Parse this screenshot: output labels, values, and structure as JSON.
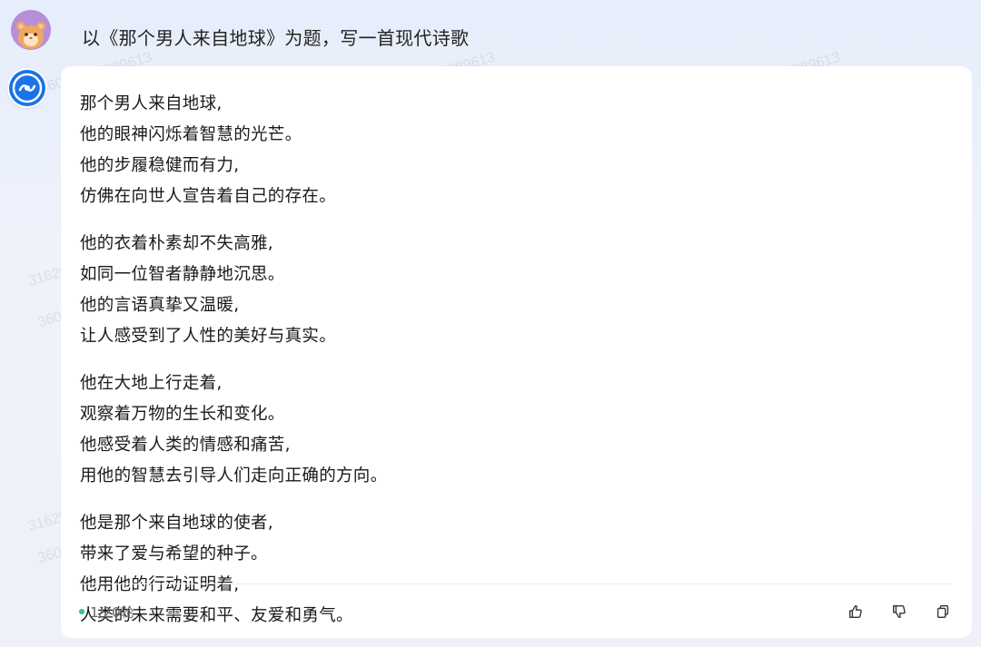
{
  "user_message": {
    "prompt": "以《那个男人来自地球》为题，写一首现代诗歌"
  },
  "assistant_message": {
    "stanzas": [
      [
        "那个男人来自地球,",
        "他的眼神闪烁着智慧的光芒。",
        "他的步履稳健而有力,",
        "仿佛在向世人宣告着自己的存在。"
      ],
      [
        "他的衣着朴素却不失高雅,",
        "如同一位智者静静地沉思。",
        "他的言语真挚又温暖,",
        "让人感受到了人性的美好与真实。"
      ],
      [
        "他在大地上行走着,",
        "观察着万物的生长和变化。",
        "他感受着人类的情感和痛苦,",
        "用他的智慧去引导人们走向正确的方向。"
      ],
      [
        "他是那个来自地球的使者,",
        "带来了爱与希望的种子。",
        "他用他的行动证明着,",
        "人类的未来需要和平、友爱和勇气。"
      ]
    ],
    "round_count": "1/20轮",
    "actions": [
      "like-icon",
      "dislike-icon",
      "copy-icon"
    ]
  },
  "watermarks": {
    "long": "360U3162989613",
    "short": "3162989613"
  },
  "colors": {
    "background": "#e9effa",
    "card": "#ffffff",
    "status_dot": "#36c38d",
    "bot_icon": "#1a73e8",
    "user_avatar": "#b78fd8"
  }
}
